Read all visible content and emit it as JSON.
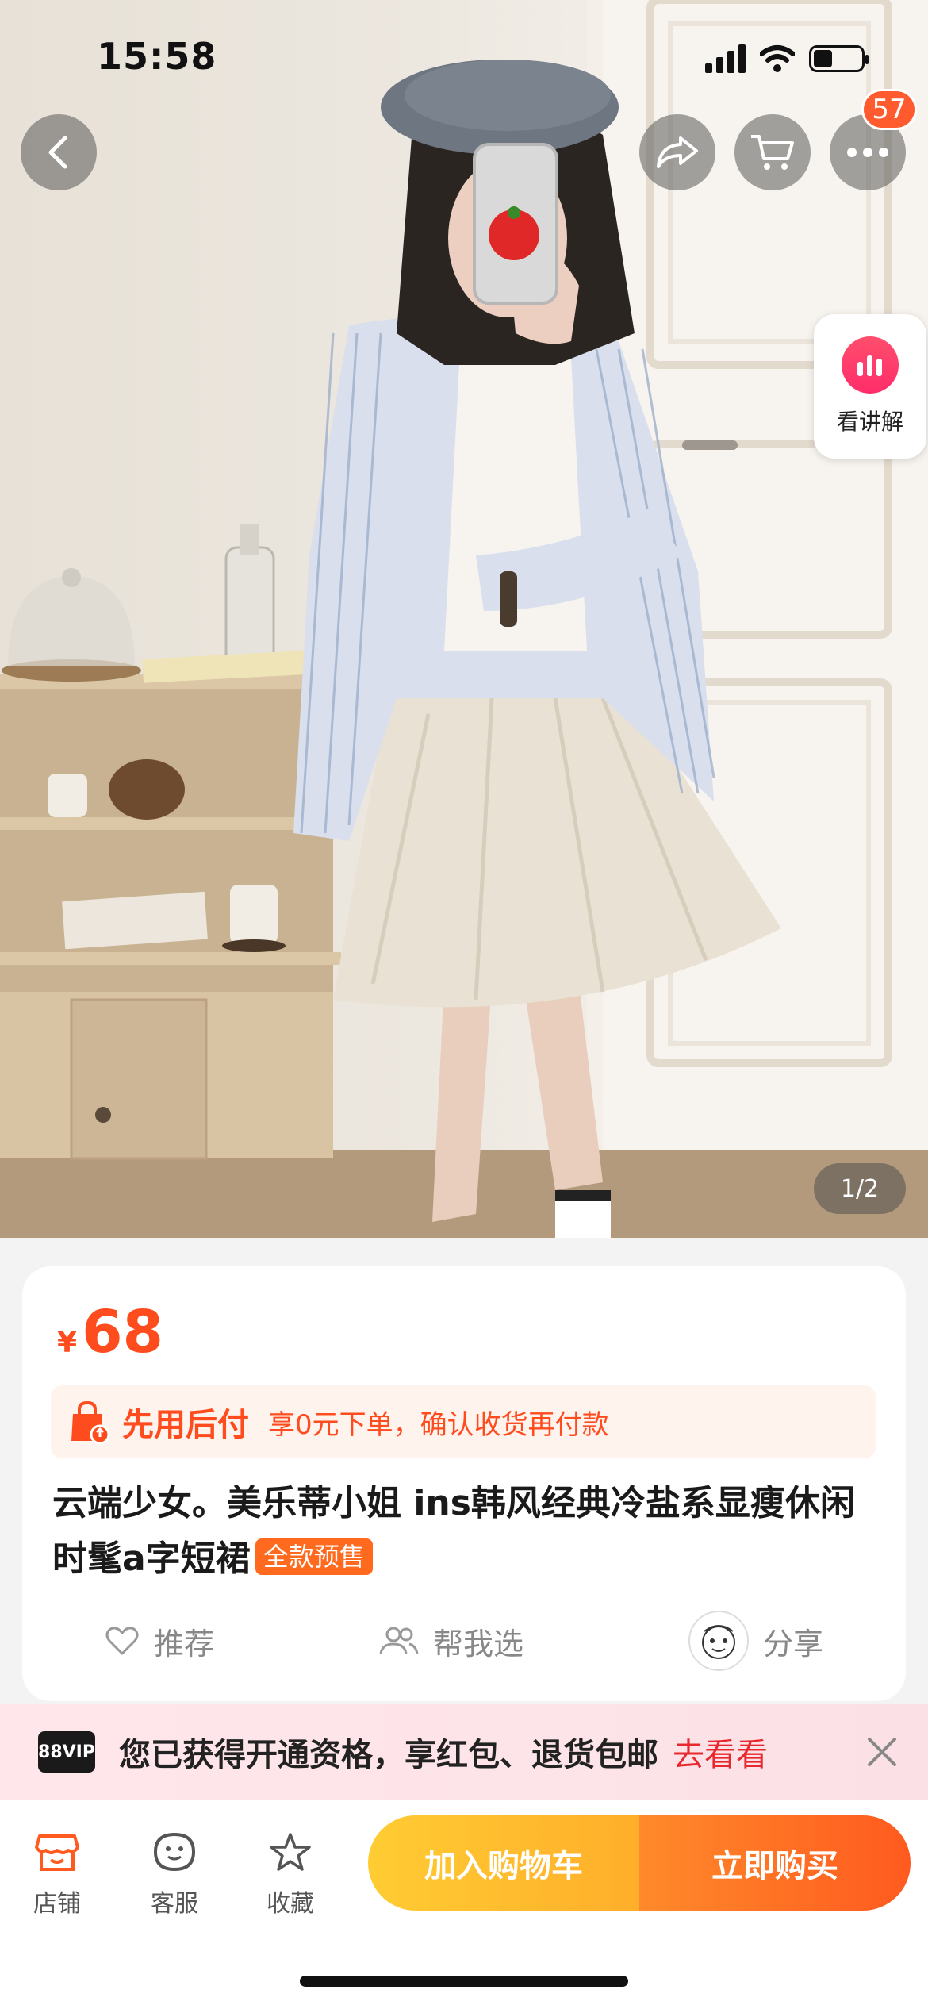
{
  "status_bar": {
    "time": "15:58"
  },
  "header": {
    "cart_badge": "57"
  },
  "hero": {
    "explain_label": "看讲解",
    "pager": "1/2"
  },
  "product": {
    "currency": "¥",
    "price": "68",
    "bnpl_title": "先用后付",
    "bnpl_desc": "享0元下单，确认收货再付款",
    "title": "云端少女。美乐蒂小姐 ins韩风经典冷盐系显瘦休闲时髦a字短裙",
    "presale_tag": "全款预售",
    "actions": {
      "recommend": "推荐",
      "help_choose": "帮我选",
      "share": "分享"
    }
  },
  "vip_banner": {
    "logo": "88VIP",
    "text": "您已获得开通资格，享红包、退货包邮",
    "link": "去看看"
  },
  "bottom_bar": {
    "store": "店铺",
    "service": "客服",
    "favorite": "收藏",
    "add_to_cart": "加入购物车",
    "buy_now": "立即购买"
  },
  "colors": {
    "accent": "#ff4c1f",
    "cart_button": "#ffb42a",
    "buy_button": "#ff6a1f",
    "vip_link": "#e8282d"
  }
}
